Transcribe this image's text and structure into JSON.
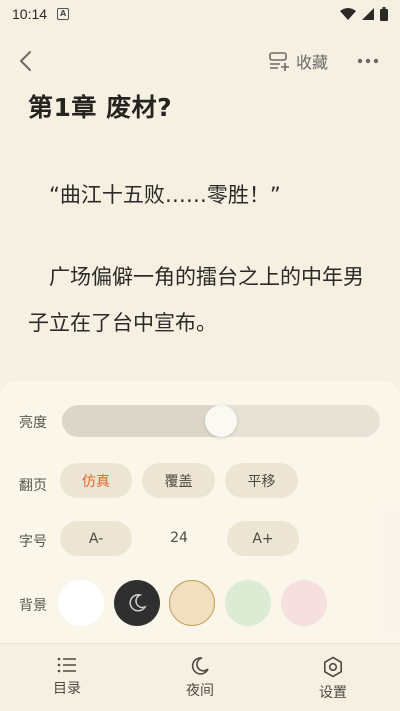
{
  "status_bar": {
    "time": "10:14",
    "notification_badge": "A"
  },
  "top_nav": {
    "favorite_label": "收藏"
  },
  "reader": {
    "chapter_title": "第1章  废材?",
    "paragraphs": [
      "“曲江十五败……零胜！”",
      "广场偏僻一角的擂台之上的中年男子立在了台中宣布。"
    ]
  },
  "settings": {
    "brightness": {
      "label": "亮度",
      "level": 0.5
    },
    "page_turn": {
      "label": "翻页",
      "options": [
        "仿真",
        "覆盖",
        "平移"
      ],
      "selected": "仿真"
    },
    "font_size": {
      "label": "字号",
      "decrease_label": "A-",
      "value": "24",
      "increase_label": "A+"
    },
    "background": {
      "label": "背景",
      "swatches": [
        "#ffffff",
        "#2f2f2f",
        "#f0e0c0",
        "#dcebd3",
        "#f7dfdf"
      ],
      "selected_index": 2
    }
  },
  "bottom_nav": {
    "items": [
      {
        "label": "目录",
        "icon": "list-icon"
      },
      {
        "label": "夜间",
        "icon": "moon-icon"
      },
      {
        "label": "设置",
        "icon": "settings-icon"
      }
    ]
  },
  "colors": {
    "background": "#f6f0e3",
    "accent": "#e0672a"
  }
}
